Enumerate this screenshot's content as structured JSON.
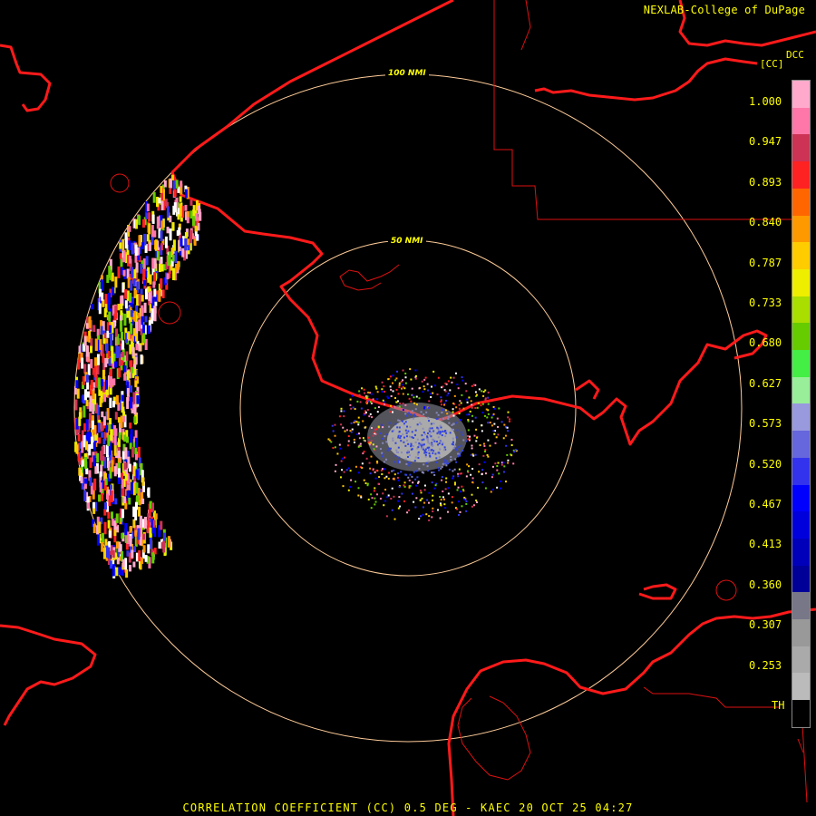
{
  "header": {
    "credit": "NEXLAB-College of DuPage"
  },
  "legend": {
    "product": "DCC",
    "unit": "[CC]",
    "ticks": [
      "1.000",
      "0.947",
      "0.893",
      "0.840",
      "0.787",
      "0.733",
      "0.680",
      "0.627",
      "0.573",
      "0.520",
      "0.467",
      "0.413",
      "0.360",
      "0.307",
      "0.253",
      "TH"
    ],
    "colors": [
      "#ffaacc",
      "#ff77a8",
      "#cc3355",
      "#ff2222",
      "#ff6600",
      "#ff9900",
      "#ffcc00",
      "#eeee00",
      "#aadd00",
      "#66cc00",
      "#44ee44",
      "#99ee99",
      "#9999dd",
      "#6666dd",
      "#3333ee",
      "#0000ff",
      "#0000dd",
      "#0000bb",
      "#000099",
      "#777788",
      "#999999",
      "#aaaaaa",
      "#bbbbbb",
      "#000000"
    ]
  },
  "rings": {
    "inner": "50 NMI",
    "outer": "100 NMI"
  },
  "footer": {
    "caption": "CORRELATION COEFFICIENT (CC) 0.5 DEG - KAEC 20 OCT 25 04:27"
  }
}
